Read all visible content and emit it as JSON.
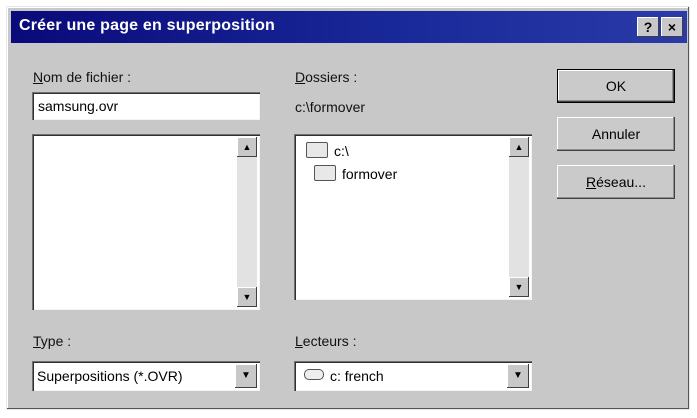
{
  "window": {
    "title": "Créer une page en superposition",
    "help_label": "?",
    "close_label": "×"
  },
  "file": {
    "label": "Nom de fichier :",
    "label_key": "N",
    "label_rest": "om de fichier :",
    "value": "samsung.ovr"
  },
  "folders": {
    "label_key": "D",
    "label_rest": "ossiers :",
    "current_path": "c:\\formover",
    "items": [
      {
        "label": "c:\\"
      },
      {
        "label": "formover"
      }
    ]
  },
  "type": {
    "label_key": "T",
    "label_rest": "ype :",
    "selected": "Superpositions (*.OVR)"
  },
  "drives": {
    "label_key": "L",
    "label_rest": "ecteurs :",
    "selected": "c: french"
  },
  "buttons": {
    "ok": "OK",
    "cancel": "Annuler",
    "network_key": "R",
    "network_rest": "éseau..."
  }
}
